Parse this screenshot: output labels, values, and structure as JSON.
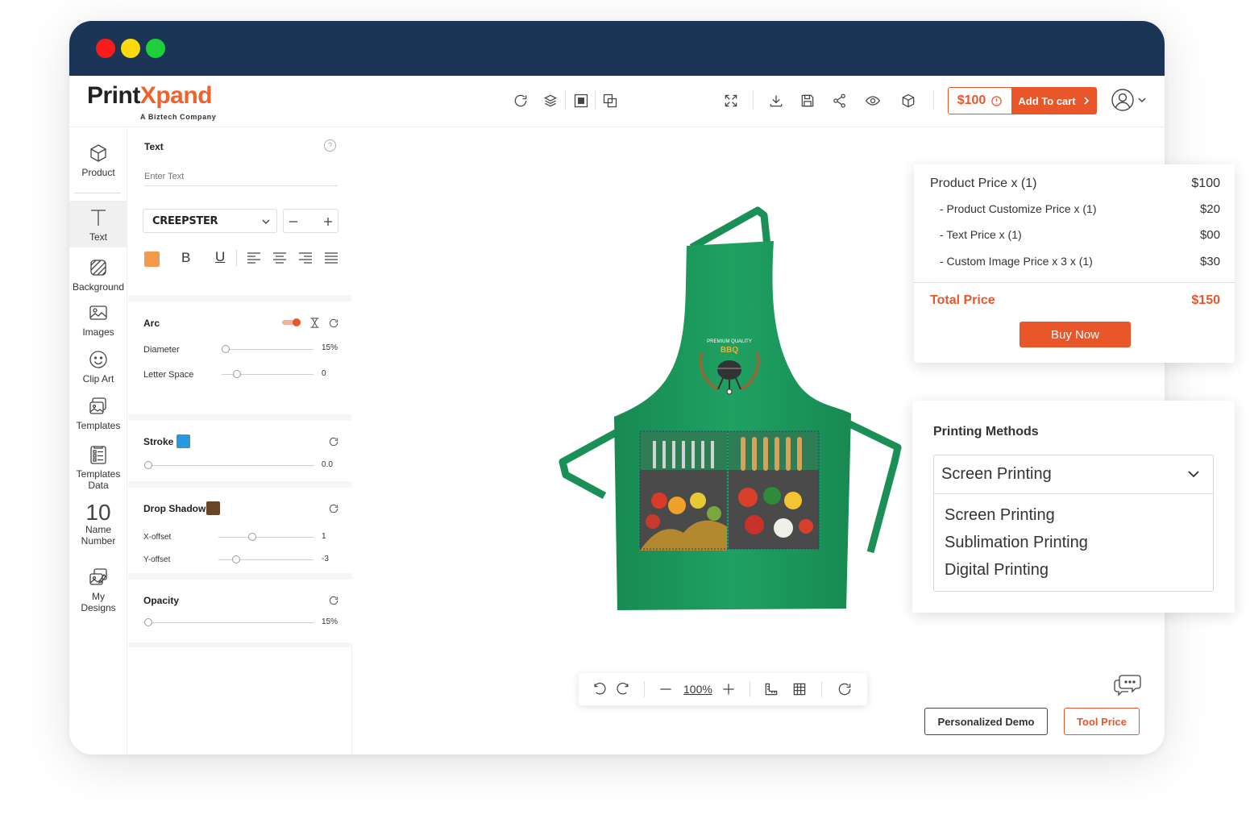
{
  "brand": {
    "logo_part1": "Print",
    "logo_part2": "Xpand",
    "tagline": "A Biztech Company"
  },
  "colors": {
    "titlebar": "#1b3556",
    "accent": "#e8562a",
    "apron": "#1f9a5e"
  },
  "header": {
    "price": "$100",
    "add_to_cart": "Add To cart",
    "icons": [
      "refresh-icon",
      "layers-icon",
      "front-icon",
      "back-icon",
      "fullscreen-icon",
      "download-icon",
      "save-icon",
      "share-icon",
      "preview-icon",
      "3d-icon",
      "user-icon"
    ]
  },
  "sidebar": {
    "items": [
      {
        "label": "Product",
        "icon": "cube-icon"
      },
      {
        "label": "Text",
        "icon": "text-icon"
      },
      {
        "label": "Background",
        "icon": "background-icon"
      },
      {
        "label": "Images",
        "icon": "image-icon"
      },
      {
        "label": "Clip Art",
        "icon": "smiley-icon"
      },
      {
        "label": "Templates",
        "icon": "templates-icon"
      },
      {
        "label": "Templates Data",
        "icon": "templates-data-icon"
      },
      {
        "label": "Name Number",
        "icon": "name-number-icon",
        "glyph": "10"
      },
      {
        "label": "My Designs",
        "icon": "my-designs-icon"
      }
    ]
  },
  "panel": {
    "text_title": "Text",
    "text_placeholder": "Enter Text",
    "font_name": "CREEPSTER",
    "text_color": "#f39a4e",
    "arc_title": "Arc",
    "diameter_label": "Diameter",
    "diameter_value": "15%",
    "letter_space_label": "Letter Space",
    "letter_space_value": "0",
    "stroke_title": "Stroke",
    "stroke_color": "#2b97dd",
    "stroke_value": "0.0",
    "shadow_title": "Drop Shadow",
    "shadow_color": "#6b4426",
    "xoffset_label": "X-offset",
    "xoffset_value": "1",
    "yoffset_label": "Y-offset",
    "yoffset_value": "-3",
    "opacity_title": "Opacity",
    "opacity_value": "15%"
  },
  "price_card": {
    "rows": [
      {
        "label": "Product Price  x  (1)",
        "value": "$100"
      },
      {
        "label": "- Product Customize Price  x  (1)",
        "value": "$20"
      },
      {
        "label": "- Text Price x (1)",
        "value": "$00"
      },
      {
        "label": "- Custom Image Price x 3 x  (1)",
        "value": "$30"
      }
    ],
    "total_label": "Total Price",
    "total_value": "$150",
    "buy_now": "Buy Now"
  },
  "printing": {
    "title": "Printing Methods",
    "selected": "Screen Printing",
    "options": [
      "Screen Printing",
      "Sublimation Printing",
      "Digital Printing"
    ]
  },
  "bottom_bar": {
    "zoom": "100%"
  },
  "footer": {
    "demo": "Personalized Demo",
    "tool_price": "Tool Price"
  }
}
